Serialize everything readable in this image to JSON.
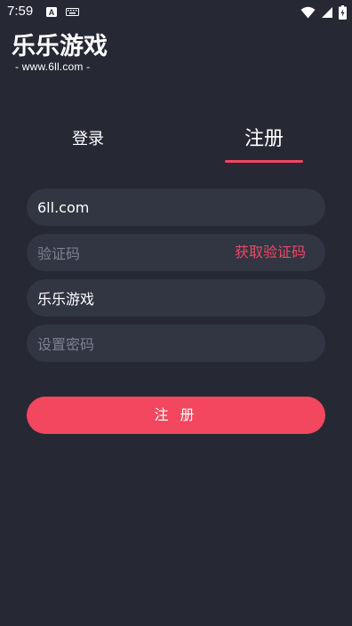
{
  "status_bar": {
    "time": "7:59"
  },
  "logo": {
    "title": "乐乐游戏",
    "subtitle": "- www.6ll.com -"
  },
  "tabs": [
    {
      "label": "登录",
      "active": false
    },
    {
      "label": "注册",
      "active": true
    }
  ],
  "form": {
    "account": {
      "value": "6ll.com"
    },
    "verify_code": {
      "placeholder": "验证码",
      "action": "获取验证码"
    },
    "nickname": {
      "value": "乐乐游戏"
    },
    "password": {
      "placeholder": "设置密码"
    },
    "submit_label": "注 册"
  },
  "colors": {
    "background": "#262934",
    "field_background": "#323542",
    "accent": "#f2475f"
  }
}
